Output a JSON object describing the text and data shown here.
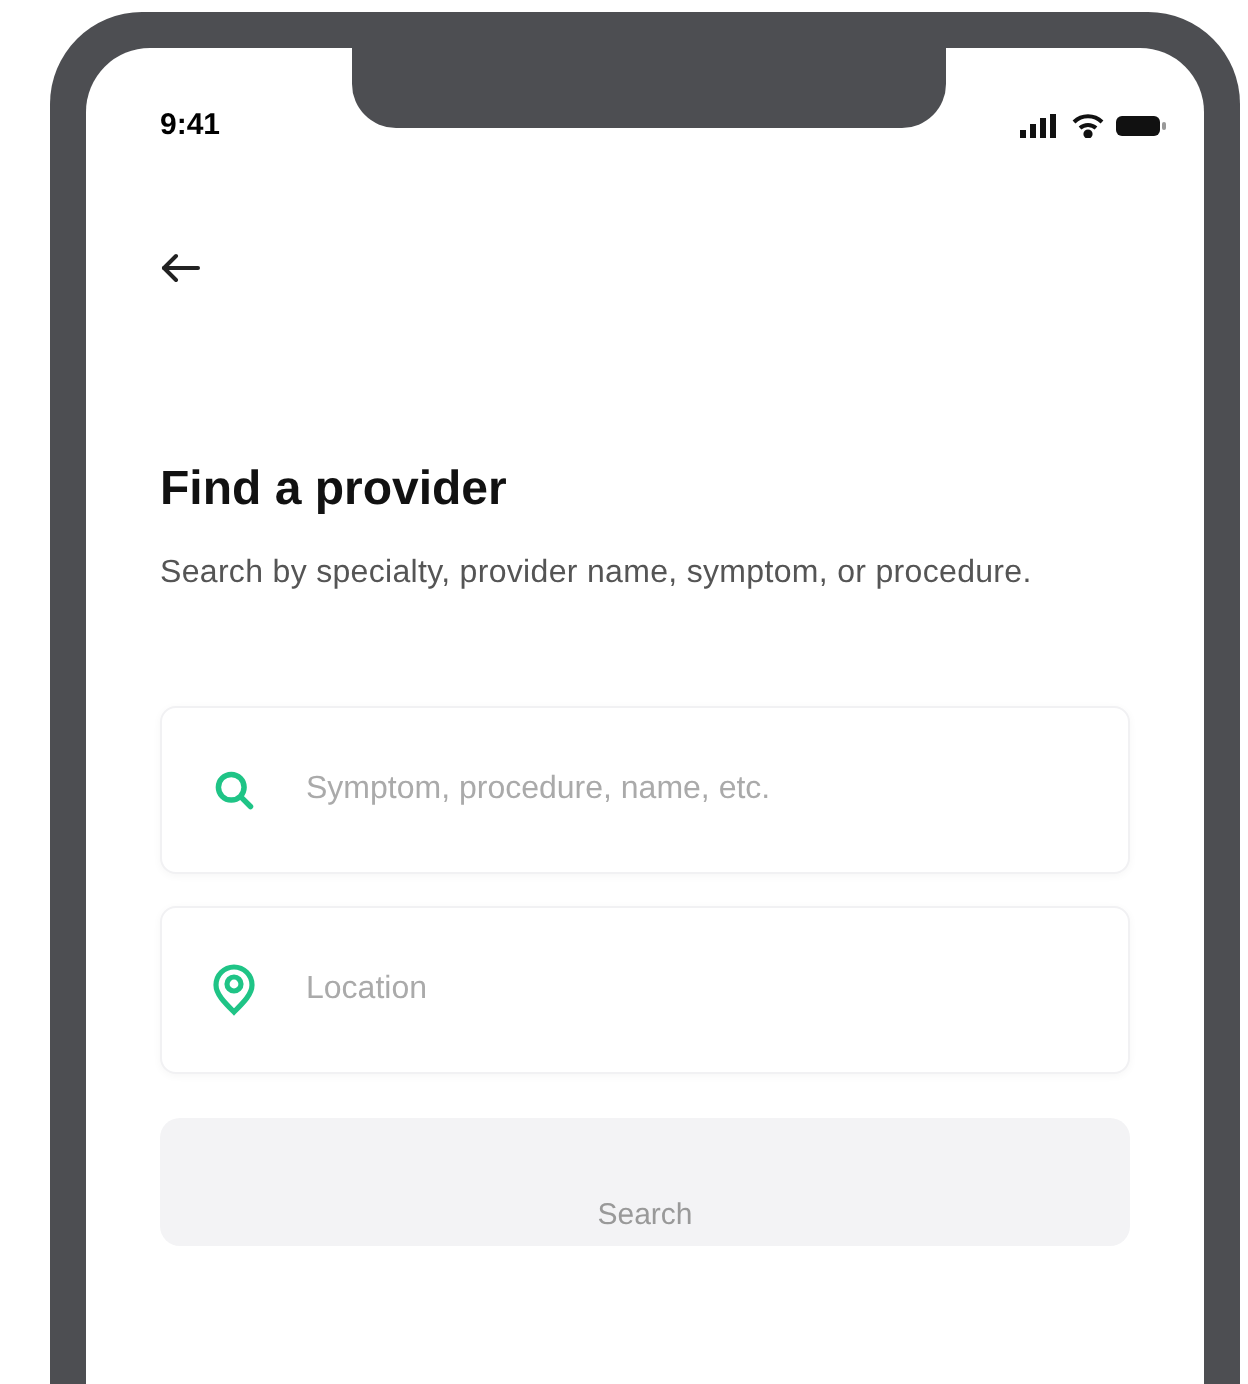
{
  "status_bar": {
    "time": "9:41"
  },
  "title": "Find a provider",
  "description": "Search by specialty, provider name, symptom, or procedure.",
  "fields": [
    {
      "kind": "search",
      "placeholder": "Symptom, procedure, name, etc."
    },
    {
      "kind": "location",
      "placeholder": "Location"
    }
  ],
  "search_button": {
    "label": "Search",
    "disabled": true
  }
}
